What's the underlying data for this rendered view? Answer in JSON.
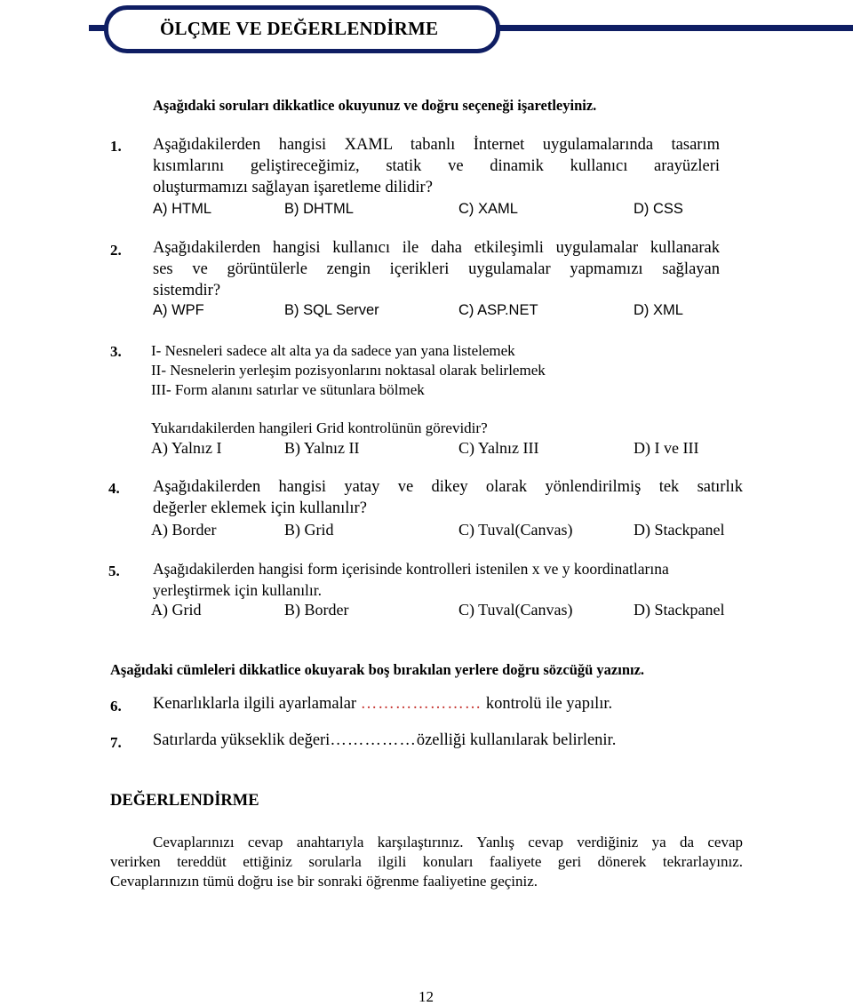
{
  "header": {
    "title": "ÖLÇME VE DEĞERLENDİRME",
    "accent_color": "#0f1e63"
  },
  "mc_section": {
    "instruction": "Aşağıdaki soruları dikkatlice okuyunuz ve doğru seçeneği işaretleyiniz.",
    "questions": [
      {
        "number": "1.",
        "lines": [
          "Aşağıdakilerden hangisi XAML tabanlı İnternet uygulamalarında tasarım",
          "kısımlarını geliştireceğimiz, statik ve dinamik kullanıcı arayüzleri",
          "oluşturmamızı sağlayan işaretleme dilidir?"
        ],
        "options": [
          "A) HTML",
          "B) DHTML",
          "C) XAML",
          "D) CSS"
        ]
      },
      {
        "number": "2.",
        "lines": [
          "Aşağıdakilerden hangisi kullanıcı ile daha etkileşimli uygulamalar kullanarak",
          "ses ve görüntülerle zengin içerikleri uygulamalar yapmamızı sağlayan",
          "sistemdir?"
        ],
        "options": [
          "A) WPF",
          "B) SQL Server",
          "C) ASP.NET",
          "D) XML"
        ]
      },
      {
        "number": "3.",
        "statements": [
          "I- Nesneleri sadece alt alta ya da sadece yan yana listelemek",
          "II- Nesnelerin yerleşim pozisyonlarını noktasal olarak belirlemek",
          "III- Form alanını satırlar ve sütunlara bölmek"
        ],
        "question": "Yukarıdakilerden hangileri Grid kontrolünün görevidir?",
        "options": [
          "A) Yalnız I",
          "B) Yalnız II",
          "C) Yalnız III",
          "D) I ve III"
        ]
      },
      {
        "number": "4.",
        "lines": [
          "Aşağıdakilerden hangisi yatay ve dikey olarak yönlendirilmiş tek satırlık",
          "değerler eklemek için kullanılır?"
        ],
        "options": [
          "A) Border",
          "B) Grid",
          "C) Tuval(Canvas)",
          "D) Stackpanel"
        ]
      },
      {
        "number": "5.",
        "lines": [
          "Aşağıdakilerden hangisi form içerisinde kontrolleri istenilen x ve y koordinatlarına",
          "yerleştirmek için kullanılır."
        ],
        "options": [
          "A) Grid",
          "B) Border",
          "C) Tuval(Canvas)",
          "D) Stackpanel"
        ]
      }
    ]
  },
  "fill_section": {
    "instruction": "Aşağıdaki cümleleri dikkatlice okuyarak boş bırakılan yerlere doğru sözcüğü yazınız.",
    "questions": [
      {
        "number": "6.",
        "before": "Kenarlıklarla ilgili ayarlamalar ",
        "blank": "…………………",
        "after": " kontrolü ile yapılır.",
        "blank_color": "#c4302b"
      },
      {
        "number": "7.",
        "before": "Satırlarda yükseklik değeri",
        "blank": "……………",
        "after": "özelliği kullanılarak belirlenir."
      }
    ]
  },
  "evaluation": {
    "title": "DEĞERLENDİRME",
    "lines": [
      "Cevaplarınızı cevap anahtarıyla karşılaştırınız. Yanlış cevap verdiğiniz ya da cevap",
      "verirken tereddüt ettiğiniz sorularla ilgili konuları faaliyete geri dönerek tekrarlayınız.",
      "Cevaplarınızın tümü doğru ise bir sonraki öğrenme faaliyetine geçiniz."
    ]
  },
  "page_number": "12"
}
